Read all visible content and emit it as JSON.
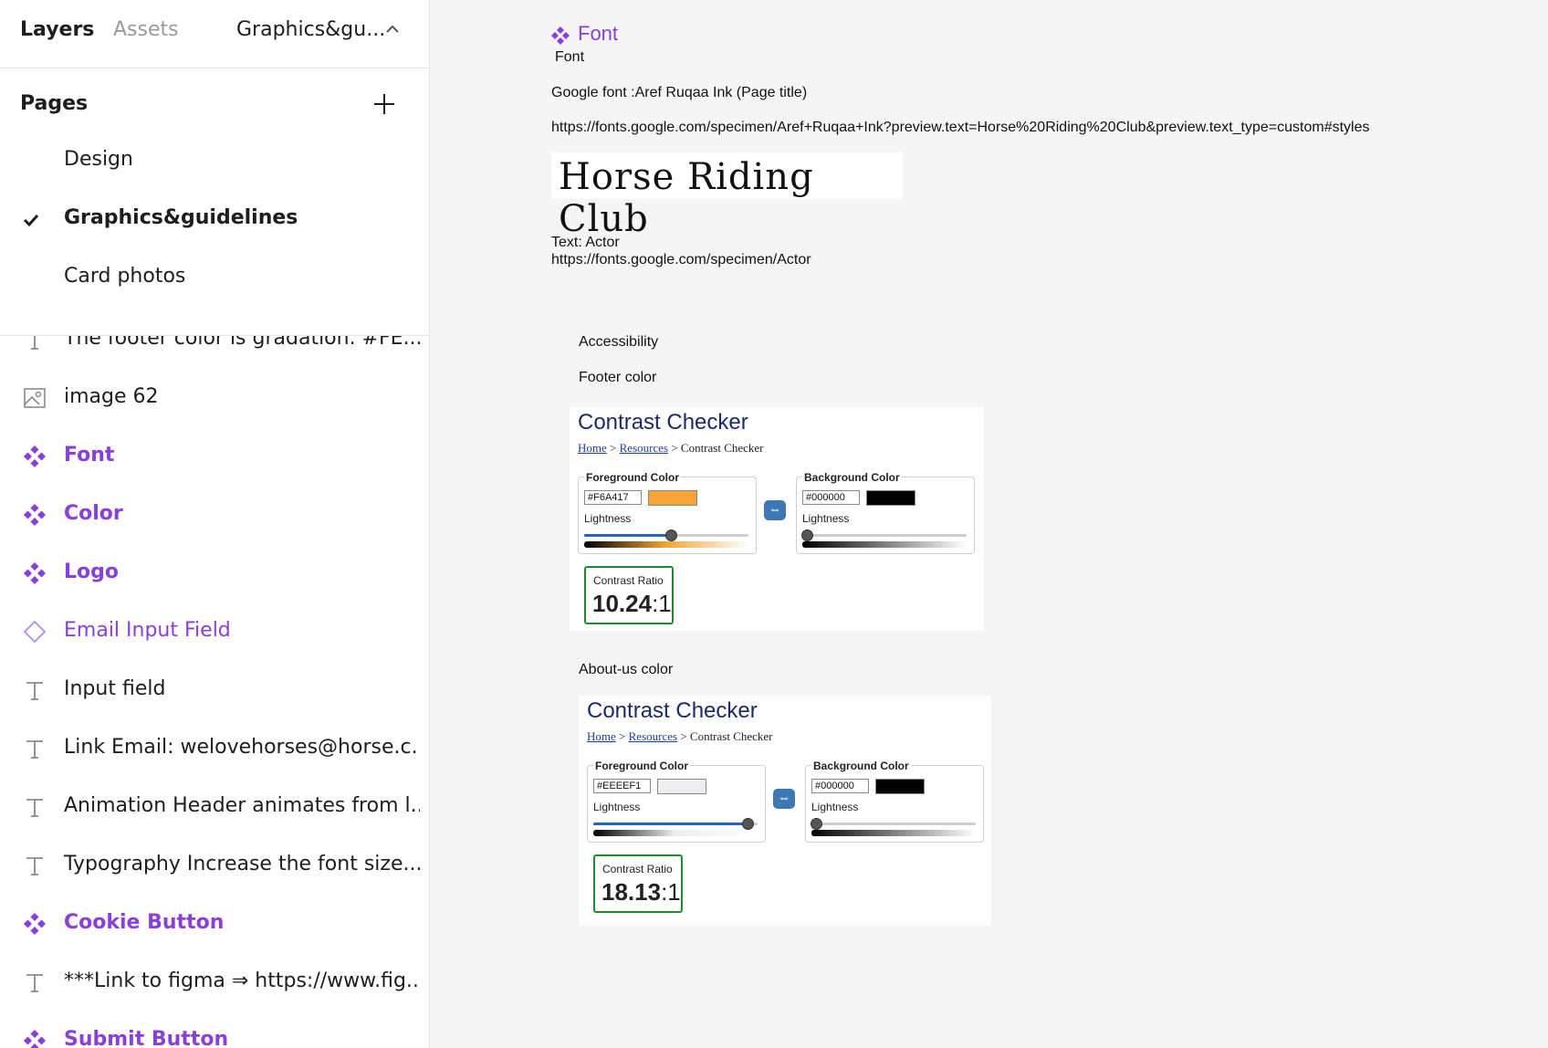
{
  "topbar": {
    "tab_layers": "Layers",
    "tab_assets": "Assets",
    "page_switcher": "Graphics&gu..."
  },
  "pages": {
    "title": "Pages",
    "items": [
      {
        "label": "Design",
        "active": false
      },
      {
        "label": "Graphics&guidelines",
        "active": true
      },
      {
        "label": "Card photos",
        "active": false
      }
    ]
  },
  "layers": [
    {
      "label": "The footer color is gradation. #FE...",
      "icon": "text-icon"
    },
    {
      "label": "image 62",
      "icon": "image-icon"
    },
    {
      "label": "Font",
      "icon": "component-icon"
    },
    {
      "label": "Color",
      "icon": "component-icon"
    },
    {
      "label": "Logo",
      "icon": "component-icon"
    },
    {
      "label": "Email Input Field",
      "icon": "instance-icon"
    },
    {
      "label": "Input field",
      "icon": "text-icon"
    },
    {
      "label": "Link Email: welovehorses@horse.c...",
      "icon": "text-icon"
    },
    {
      "label": "Animation Header animates from l...",
      "icon": "text-icon"
    },
    {
      "label": "Typography Increase the font size...",
      "icon": "text-icon"
    },
    {
      "label": "Cookie Button",
      "icon": "component-icon"
    },
    {
      "label": "***Link to figma ⇒ https://www.fig...",
      "icon": "text-icon"
    },
    {
      "label": "Submit Button",
      "icon": "component-icon"
    }
  ],
  "canvas": {
    "frame_title": "Font",
    "frame_sub": "Font",
    "google_font": "Google font :Aref Ruqaa Ink (Page title)",
    "google_font_url": "https://fonts.google.com/specimen/Aref+Ruqaa+Ink?preview.text=Horse%20Riding%20Club&preview.text_type=custom#styles",
    "sample_text": "Horse Riding Club",
    "text_font": "Text: Actor",
    "text_font_url": "https://fonts.google.com/specimen/Actor",
    "accessibility": "Accessibility",
    "footer_color": "Footer color",
    "about_color": "About-us color"
  },
  "checker_common": {
    "title": "Contrast Checker",
    "crumb_home": "Home",
    "crumb_sep1": " > ",
    "crumb_resources": "Resources",
    "crumb_sep2": " > Contrast Checker",
    "fg_title": "Foreground Color",
    "bg_title": "Background Color",
    "lightness": "Lightness",
    "ratio_label": "Contrast Ratio",
    "ratio_suffix": ":1"
  },
  "checker_footer": {
    "fg_hex": "#F6A417",
    "bg_hex": "#000000",
    "fg_color": "#f6a437",
    "bg_color": "#000000",
    "fg_lightness": 0.53,
    "bg_lightness": 0.0,
    "ratio": "10.24"
  },
  "checker_about": {
    "fg_hex": "#EEEEF1",
    "bg_hex": "#000000",
    "fg_color": "#eeeef1",
    "bg_color": "#000000",
    "fg_lightness": 0.94,
    "bg_lightness": 0.0,
    "ratio": "18.13"
  },
  "colors": {
    "component_purple": "#8b3fd9",
    "contrast_pass_green": "#1f8b2a"
  }
}
